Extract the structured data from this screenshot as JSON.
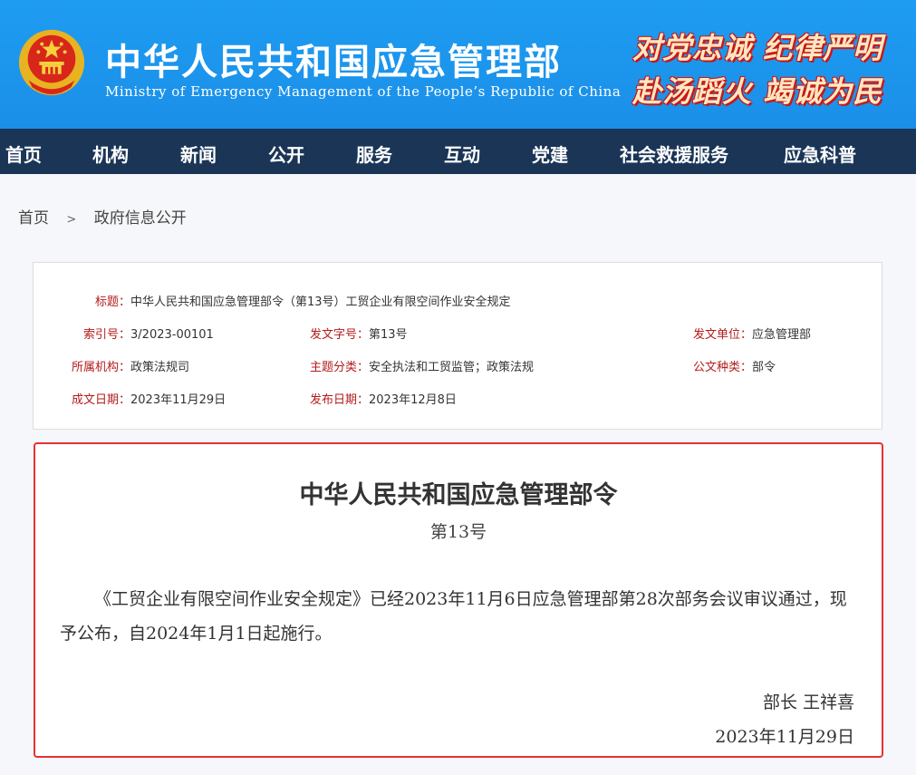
{
  "header": {
    "title": "中华人民共和国应急管理部",
    "subtitle": "Ministry of Emergency Management of the People’s Republic of China",
    "slogan_line1": "对党忠诚 纪律严明",
    "slogan_line2": "赴汤蹈火 竭诚为民",
    "emblem_icon": "national-emblem-icon"
  },
  "nav": {
    "items": [
      "首页",
      "机构",
      "新闻",
      "公开",
      "服务",
      "互动",
      "党建",
      "社会救援服务",
      "应急科普"
    ]
  },
  "breadcrumb": {
    "home": "首页",
    "separator": ">",
    "current": "政府信息公开"
  },
  "info": {
    "title_label": "标题：",
    "title_value": "中华人民共和国应急管理部令（第13号）工贸企业有限空间作业安全规定",
    "index_label": "索引号：",
    "index_value": "3/2023-00101",
    "docno_label": "发文字号：",
    "docno_value": "第13号",
    "issuer_label": "发文单位：",
    "issuer_value": "应急管理部",
    "org_label": "所属机构：",
    "org_value": "政策法规司",
    "topic_label": "主题分类：",
    "topic_value": "安全执法和工贸监管；政策法规",
    "type_label": "公文种类：",
    "type_value": "部令",
    "written_label": "成文日期：",
    "written_value": "2023年11月29日",
    "published_label": "发布日期：",
    "published_value": "2023年12月8日"
  },
  "document": {
    "title": "中华人民共和国应急管理部令",
    "number": "第13号",
    "body": "《工贸企业有限空间作业安全规定》已经2023年11月6日应急管理部第28次部务会议审议通过，现予公布，自2024年1月1日起施行。",
    "signer": "部长  王祥喜",
    "date": "2023年11月29日"
  },
  "colors": {
    "header_blue": "#1b8fe8",
    "nav_dark": "#1b3556",
    "label_red": "#b31b1b",
    "doc_border_red": "#e63232"
  }
}
